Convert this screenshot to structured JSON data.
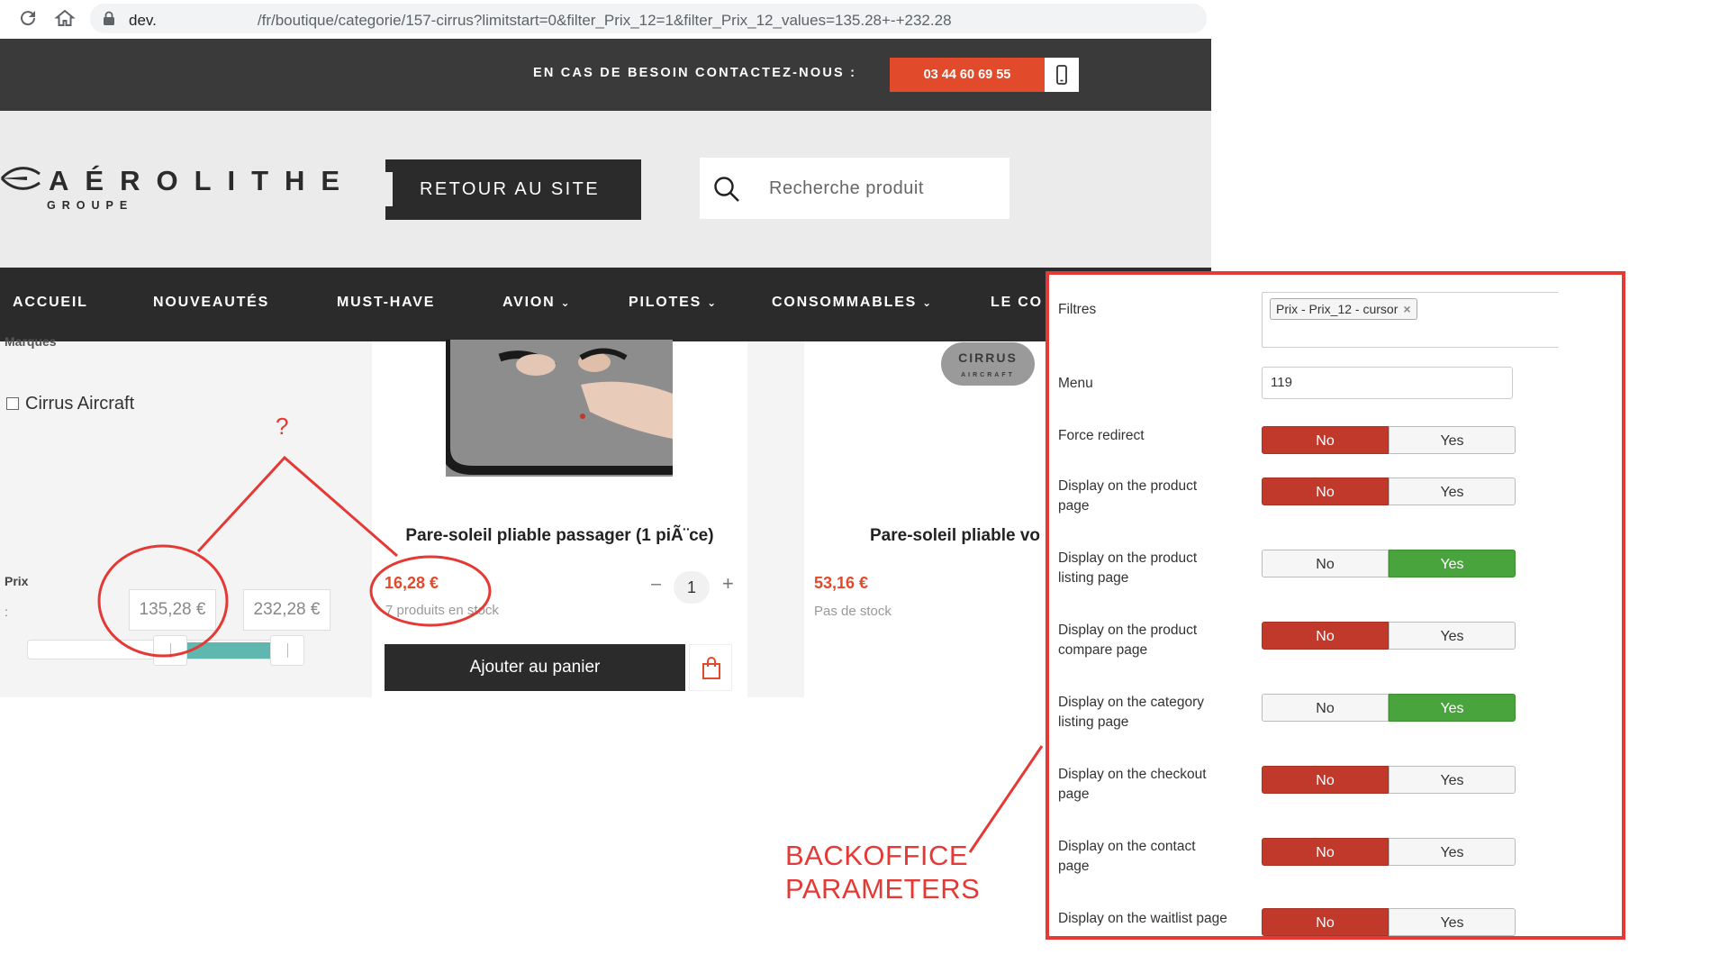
{
  "browser": {
    "url_host": "dev.",
    "url_path": "/fr/boutique/categorie/157-cirrus?limitstart=0&filter_Prix_12=1&filter_Prix_12_values=135.28+-+232.28"
  },
  "contact": {
    "label": "EN CAS DE BESOIN CONTACTEZ-NOUS :",
    "phone": "03 44 60 69 55"
  },
  "header": {
    "logo_name": "AÉROLITHE",
    "logo_sub": "GROUPE",
    "back_button": "RETOUR AU SITE",
    "search_placeholder": "Recherche produit"
  },
  "menu": [
    {
      "label": "ACCUEIL",
      "dropdown": false
    },
    {
      "label": "NOUVEAUTÉS",
      "dropdown": false
    },
    {
      "label": "MUST-HAVE",
      "dropdown": false
    },
    {
      "label": "AVION",
      "dropdown": true
    },
    {
      "label": "PILOTES",
      "dropdown": true
    },
    {
      "label": "CONSOMMABLES",
      "dropdown": true
    },
    {
      "label": "LE CO",
      "dropdown": false
    }
  ],
  "sidebar": {
    "marques_label": "Marques",
    "brand_checkbox_label": "Cirrus Aircraft",
    "brand_checked": false,
    "price_label": "Prix",
    "price_colon": ":",
    "price_min": "135,28 €",
    "price_max": "232,28 €"
  },
  "products": [
    {
      "title": "Pare-soleil pliable passager (1 piÃ¨ce)",
      "price": "16,28 €",
      "stock": "7 produits en stock",
      "quantity": "1",
      "add_to_cart": "Ajouter au panier"
    },
    {
      "title": "Pare-soleil pliable vo",
      "brand_logo_text": "CIRRUS",
      "brand_logo_sub": "AIRCRAFT",
      "price": "53,16 €",
      "stock": "Pas de stock"
    }
  ],
  "annotations": {
    "question": "?",
    "backoffice": "BACKOFFICE\nPARAMETERS"
  },
  "backoffice": {
    "filters_label": "Filtres",
    "filter_chip": "Prix - Prix_12 - cursor",
    "menu_label": "Menu",
    "menu_value": "119",
    "no_label": "No",
    "yes_label": "Yes",
    "toggles": [
      {
        "label": "Force redirect",
        "value": "No"
      },
      {
        "label": "Display on the product page",
        "value": "No"
      },
      {
        "label": "Display on the product listing page",
        "value": "Yes"
      },
      {
        "label": "Display on the product compare page",
        "value": "No"
      },
      {
        "label": "Display on the category listing page",
        "value": "Yes"
      },
      {
        "label": "Display on the checkout page",
        "value": "No"
      },
      {
        "label": "Display on the contact page",
        "value": "No"
      },
      {
        "label": "Display on the waitlist page",
        "value": "No"
      }
    ]
  },
  "colors": {
    "accent_red": "#e24a2c",
    "annotation_red": "#e53935",
    "toggle_no": "#c0392b",
    "toggle_yes": "#4aa43e",
    "dark": "#2b2b2b",
    "slider_teal": "#5fb7b0"
  }
}
